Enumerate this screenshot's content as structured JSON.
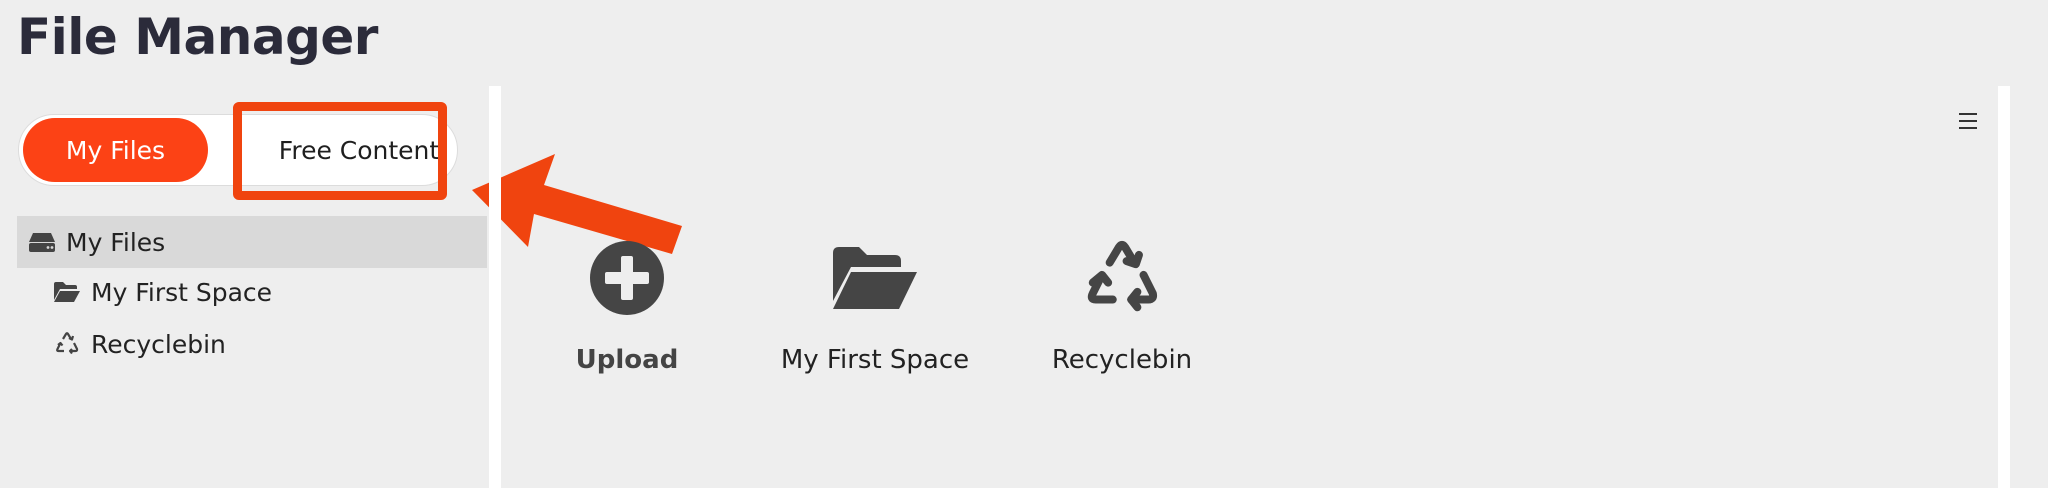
{
  "app": {
    "title": "File Manager"
  },
  "toggle": {
    "my_files": "My Files",
    "free_content": "Free Content"
  },
  "sidebar": {
    "root": {
      "label": "My Files",
      "icon": "drive-icon"
    },
    "items": [
      {
        "label": "My First Space",
        "icon": "folder-open-icon"
      },
      {
        "label": "Recyclebin",
        "icon": "recycle-icon"
      }
    ]
  },
  "main": {
    "tiles": [
      {
        "label": "Upload",
        "icon": "plus-circle-icon"
      },
      {
        "label": "My First Space",
        "icon": "folder-open-icon"
      },
      {
        "label": "Recyclebin",
        "icon": "recycle-icon"
      }
    ],
    "menu_icon": "hamburger-icon"
  },
  "colors": {
    "accent": "#fc4215",
    "annotation": "#f0440f",
    "icon": "#454545"
  }
}
